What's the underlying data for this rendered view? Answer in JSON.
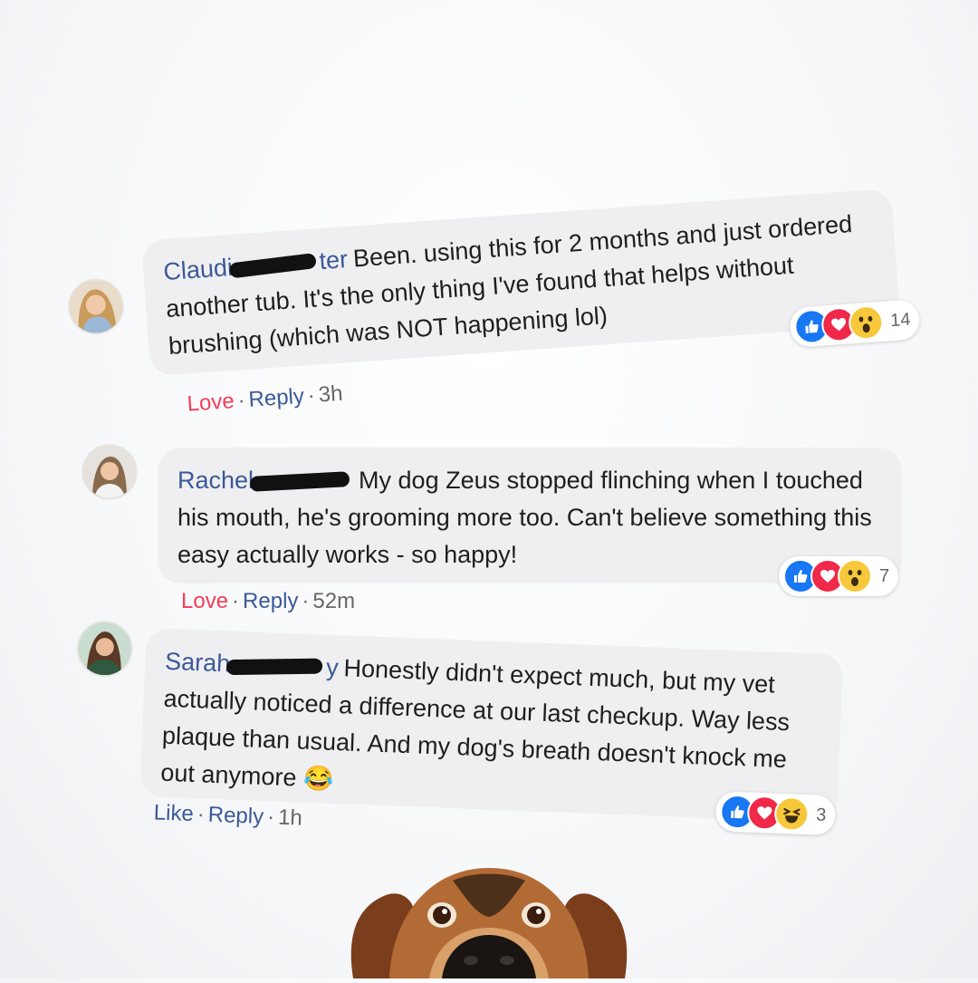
{
  "comments": [
    {
      "author_visible": "Claudi",
      "author_tail": "ter",
      "text": "Been. using this for 2 months and just ordered another tub. It's the only thing I've found that helps without brushing (which was NOT happening lol)",
      "reaction_count": "14",
      "action_primary": "Love",
      "action_reply": "Reply",
      "time": "3h"
    },
    {
      "author_visible": "Rachel",
      "author_tail": "",
      "text": "My dog Zeus stopped flinching when I touched his mouth, he's grooming more too. Can't believe something this easy actually works - so happy!",
      "reaction_count": "7",
      "action_primary": "Love",
      "action_reply": "Reply",
      "time": "52m"
    },
    {
      "author_visible": "Sarah",
      "author_tail": "y",
      "text": "Honestly didn't expect much, but my vet actually noticed a difference at our last checkup. Way less plaque than usual. And my dog's breath doesn't knock me out anymore",
      "emoji": "😂",
      "reaction_count": "3",
      "action_primary": "Like",
      "action_reply": "Reply",
      "time": "1h"
    }
  ],
  "dot": "·",
  "icons": {
    "reactions": [
      "like-reaction-icon",
      "love-reaction-icon",
      "wow-reaction-icon",
      "haha-reaction-icon"
    ]
  },
  "colors": {
    "author": "#3b5998",
    "bubble": "#efeff1",
    "love_action": "#f33e58",
    "like_action": "#3b5998",
    "like": "#1877f2",
    "love": "#f0284a",
    "wow": "#f7c83b"
  }
}
